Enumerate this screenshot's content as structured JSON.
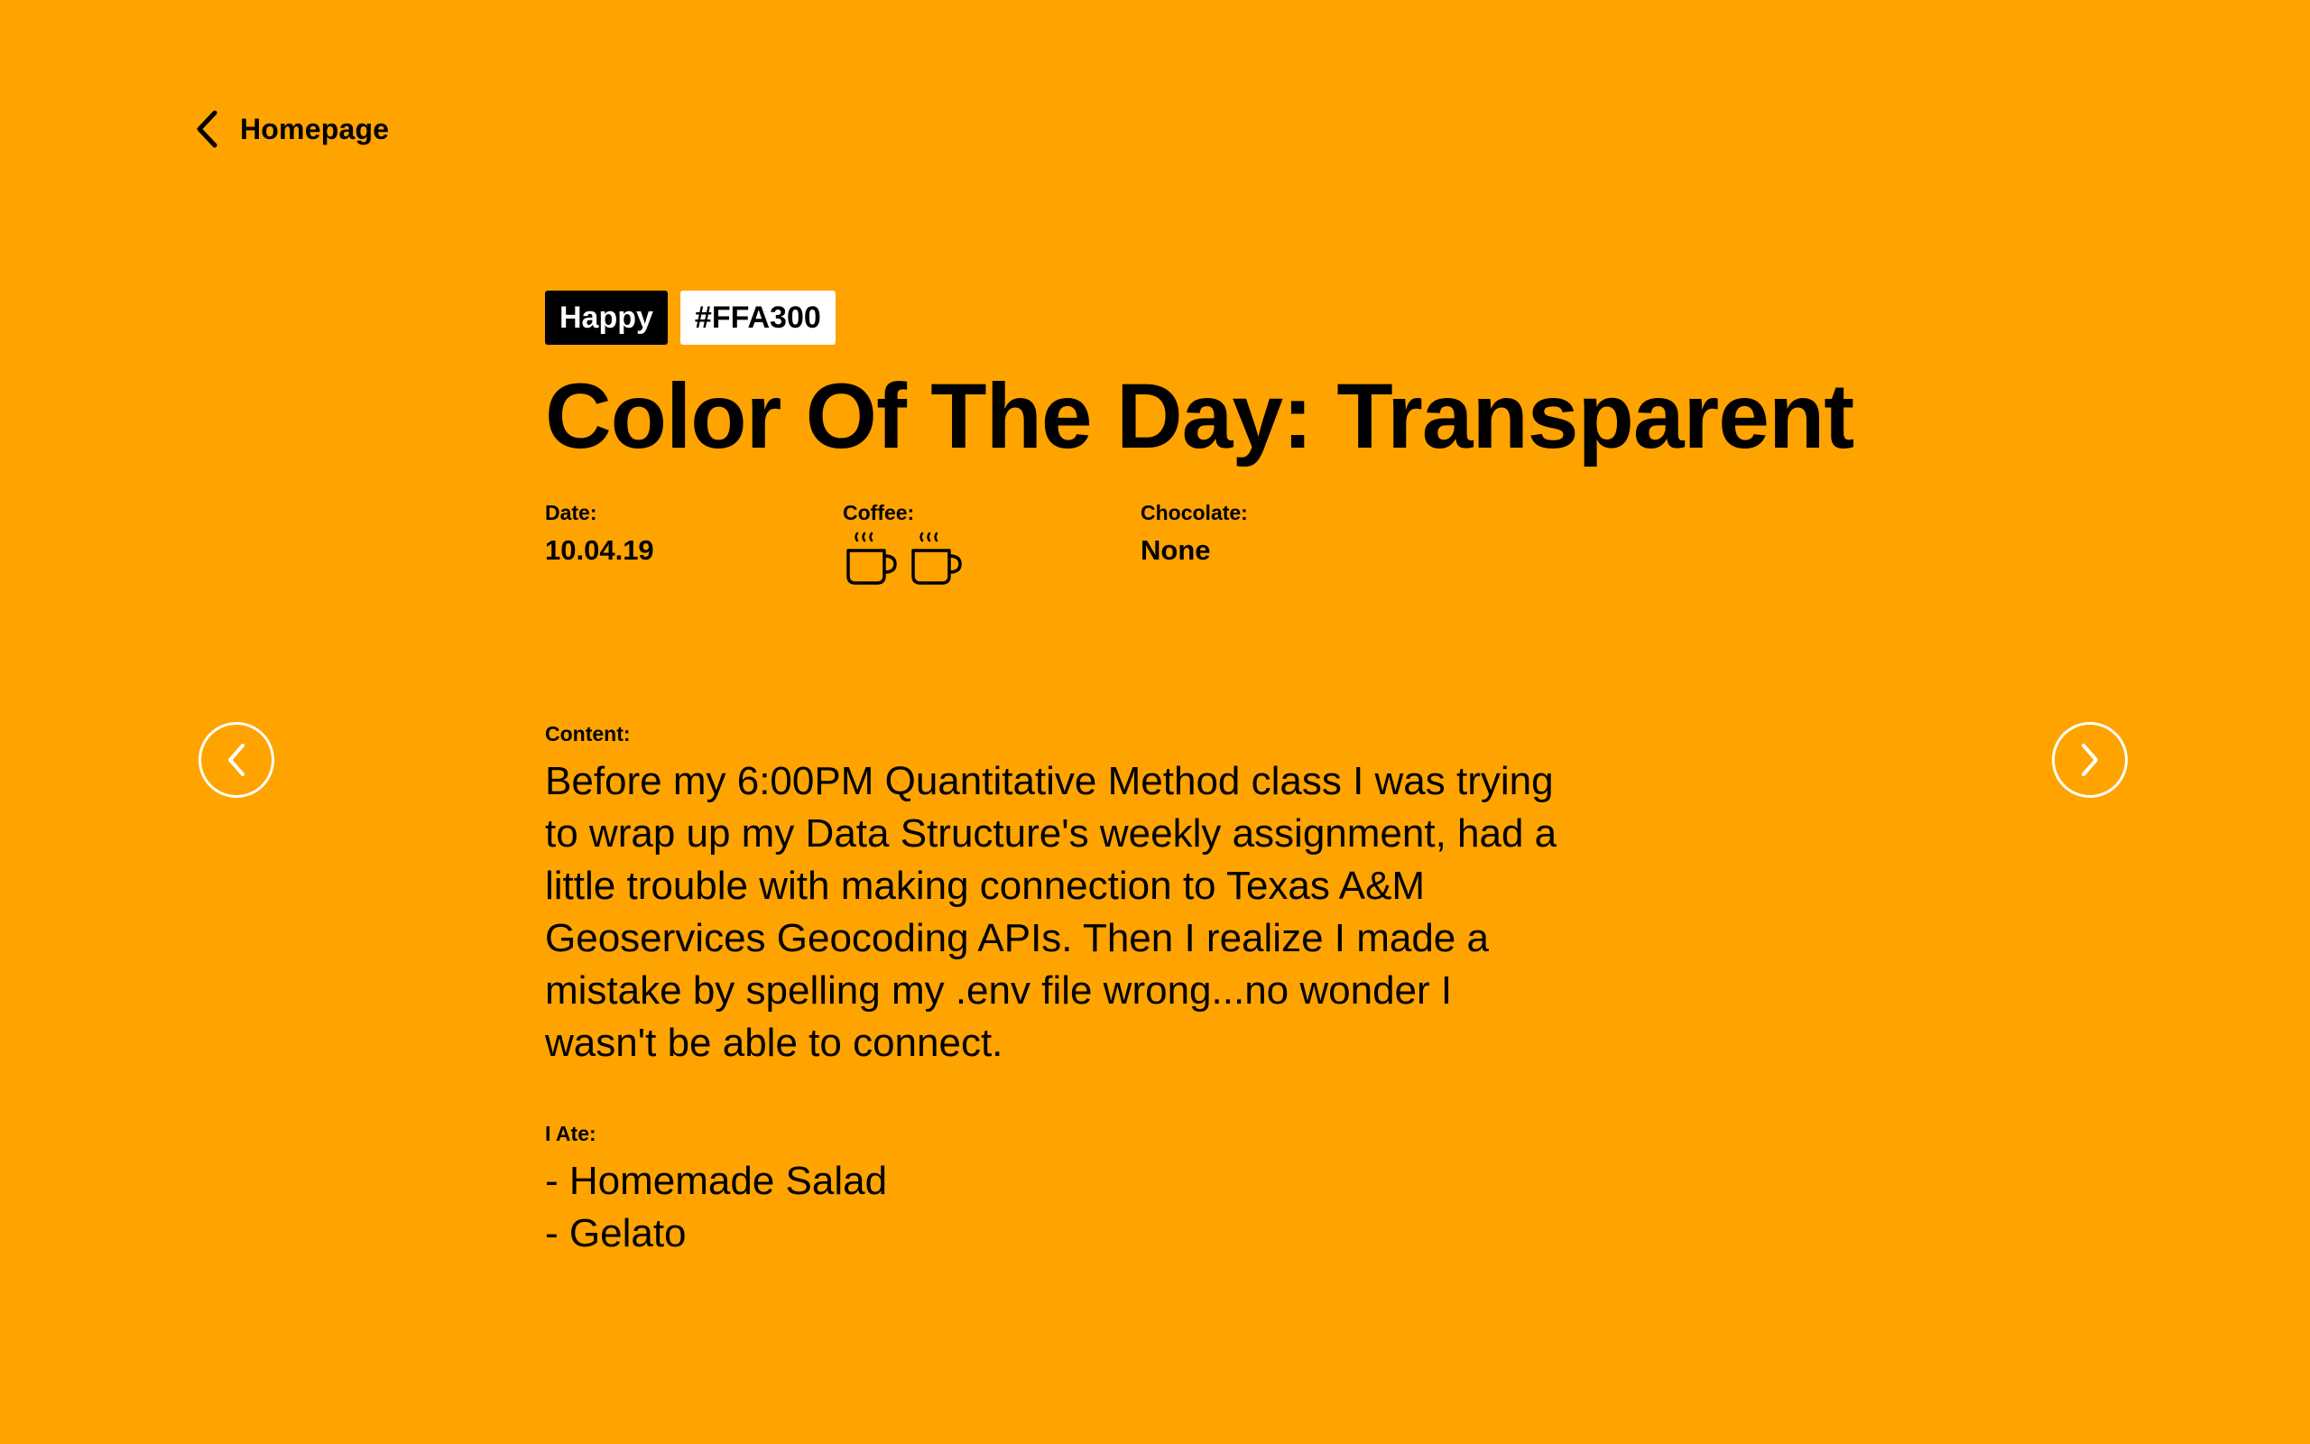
{
  "nav": {
    "back_label": "Homepage"
  },
  "tags": {
    "mood": "Happy",
    "hex": "#FFA300"
  },
  "title": "Color Of The Day: Transparent",
  "meta": {
    "date_label": "Date:",
    "date_value": "10.04.19",
    "coffee_label": "Coffee:",
    "coffee_cups": 2,
    "coffee_icon": "coffee-cup-icon",
    "chocolate_label": "Chocolate:",
    "chocolate_value": "None"
  },
  "content": {
    "label": "Content:",
    "text": "Before my 6:00PM Quantitative Method class I was trying to wrap up my Data Structure's weekly assignment, had a little trouble with making connection to Texas A&M Geoservices Geocoding APIs. Then I realize I made a mistake by spelling my .env file wrong...no wonder I wasn't be able to connect."
  },
  "ate": {
    "label": "I Ate:",
    "items": [
      "- Homemade Salad",
      "- Gelato"
    ]
  },
  "icons": {
    "back": "chevron-left-icon",
    "prev": "arrow-left-circle-icon",
    "next": "arrow-right-circle-icon"
  },
  "colors": {
    "background": "#FFA300",
    "mood_tag_bg": "#000000",
    "hex_tag_bg": "#FFFFFF",
    "nav_arrow_stroke": "#FFFFFF"
  }
}
